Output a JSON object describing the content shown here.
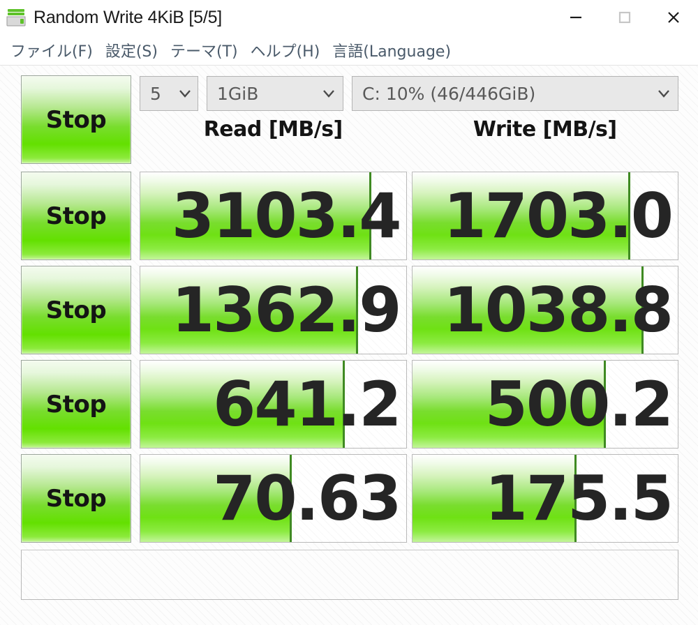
{
  "window": {
    "title": "Random Write 4KiB [5/5]",
    "icon": "disk-drive-icon",
    "controls": {
      "minimize": "minimize-icon",
      "maximize": "maximize-icon",
      "close": "close-icon"
    }
  },
  "menubar": {
    "items": [
      {
        "label": "ファイル(F)"
      },
      {
        "label": "設定(S)"
      },
      {
        "label": "テーマ(T)"
      },
      {
        "label": "ヘルプ(H)"
      },
      {
        "label": "言語(Language)"
      }
    ]
  },
  "toolbar": {
    "all_button_label": "Stop",
    "count_value": "5",
    "size_value": "1GiB",
    "drive_value": "C: 10% (46/446GiB)",
    "chevron_icon": "chevron-down-icon"
  },
  "headers": {
    "read": "Read [MB/s]",
    "write": "Write [MB/s]"
  },
  "rows": [
    {
      "button_label": "Stop",
      "read_value": "3103.4",
      "read_fill_pct": 87,
      "write_value": "1703.0",
      "write_fill_pct": 82
    },
    {
      "button_label": "Stop",
      "read_value": "1362.9",
      "read_fill_pct": 82,
      "write_value": "1038.8",
      "write_fill_pct": 87
    },
    {
      "button_label": "Stop",
      "read_value": "641.2",
      "read_fill_pct": 77,
      "write_value": "500.2",
      "write_fill_pct": 73
    },
    {
      "button_label": "Stop",
      "read_value": "70.63",
      "read_fill_pct": 57,
      "write_value": "175.5",
      "write_fill_pct": 62
    }
  ],
  "status": {
    "text": ""
  },
  "colors": {
    "accent_green": "#63e000",
    "fill_edge": "#3f8a22",
    "menu_text": "#4a5a6a",
    "combo_bg": "#e8e8e8"
  }
}
